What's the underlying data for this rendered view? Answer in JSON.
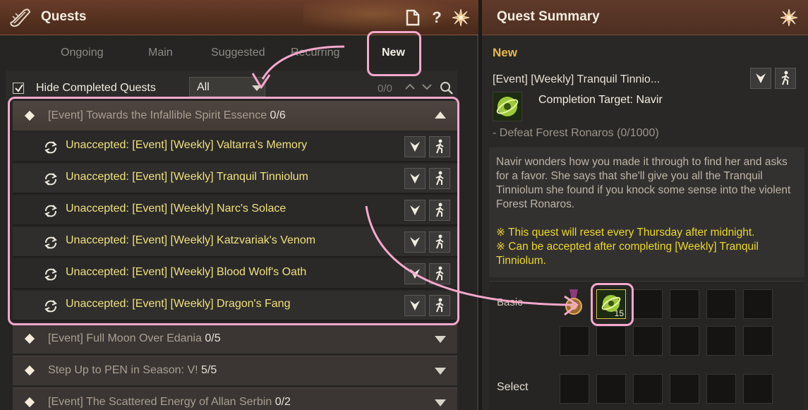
{
  "left_panel": {
    "title": "Quests",
    "tabs": [
      "Ongoing",
      "Main",
      "Suggested",
      "Recurring",
      "New"
    ],
    "active_tab": "New",
    "filter": {
      "hide_completed_label": "Hide Completed Quests",
      "hide_completed_checked": true,
      "dropdown_value": "All",
      "count": "0/0"
    },
    "groups": [
      {
        "title": "[Event] Towards the Infallible Spirit Essence",
        "progress": "0/6",
        "expanded": true,
        "items": [
          "Unaccepted: [Event] [Weekly] Valtarra's Memory",
          "Unaccepted: [Event] [Weekly] Tranquil Tinniolum",
          "Unaccepted: [Event] [Weekly] Narc's Solace",
          "Unaccepted: [Event] [Weekly] Katzvariak's Venom",
          "Unaccepted: [Event] [Weekly] Blood Wolf's Oath",
          "Unaccepted: [Event] [Weekly] Dragon's Fang"
        ]
      },
      {
        "title": "[Event] Full Moon Over Edania",
        "progress": "0/5",
        "expanded": false
      },
      {
        "title": "Step Up to PEN in Season: V!",
        "progress": "5/5",
        "expanded": false
      },
      {
        "title": "[Event] The Scattered Energy of Allan Serbin",
        "progress": "0/2",
        "expanded": false
      }
    ]
  },
  "right_panel": {
    "title": "Quest Summary",
    "status": "New",
    "quest_name": "[Event] [Weekly] Tranquil Tinnio...",
    "completion_target": "Completion Target: Navir",
    "objective": "- Defeat Forest Ronaros (0/1000)",
    "description": "Navir wonders how you made it through to find her and asks for a favor. She says that she'll give you all the Tranquil Tinniolum she found if you knock some sense into the violent Forest Ronaros.",
    "note_reset": "※ This quest will reset every Thursday after midnight.",
    "note_accept": "※ Can be accepted after completing [Weekly] Tranquil Tinniolum.",
    "rewards": {
      "basic_label": "Basic",
      "select_label": "Select",
      "basic_item_count": "15"
    }
  },
  "colors": {
    "accent_new": "#e9b84a",
    "quest_item_text": "#efe07e",
    "note_text": "#ecd72c",
    "annotation_pink": "#f5a8cc"
  }
}
